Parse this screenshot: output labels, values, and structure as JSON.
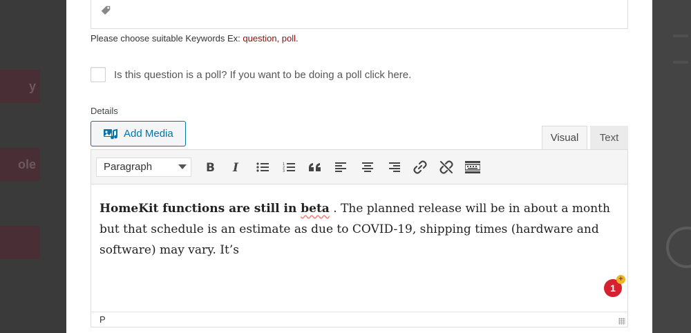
{
  "background": {
    "buttons": [
      "y",
      "ole",
      ""
    ]
  },
  "keywords": {
    "hint_prefix": "Please choose suitable Keywords Ex: ",
    "hint_examples": "question, poll",
    "hint_suffix": "."
  },
  "poll": {
    "label": "Is this question is a poll? If you want to be doing a poll click here.",
    "checked": false
  },
  "details": {
    "label": "Details",
    "add_media_label": "Add Media",
    "tabs": [
      {
        "label": "Visual",
        "active": true
      },
      {
        "label": "Text",
        "active": false
      }
    ],
    "toolbar": {
      "format_select": "Paragraph",
      "buttons": [
        "bold-icon",
        "italic-icon",
        "bullet-list-icon",
        "numbered-list-icon",
        "blockquote-icon",
        "align-left-icon",
        "align-center-icon",
        "align-right-icon",
        "link-icon",
        "unlink-icon",
        "toolbar-toggle-icon"
      ]
    },
    "content": {
      "bold_part": "HomeKit functions are still in ",
      "bold_misspelled": "beta",
      "rest": " . The planned release will be in about a month but that schedule is an estimate as due to COVID-19, shipping times (hardware and software) may vary. It’s"
    },
    "badge_count": "1",
    "badge_plus": "+",
    "status_path": "P"
  },
  "colors": {
    "accent": "#0073aa",
    "example_text": "#8b0c0c",
    "badge": "#d6212f"
  }
}
